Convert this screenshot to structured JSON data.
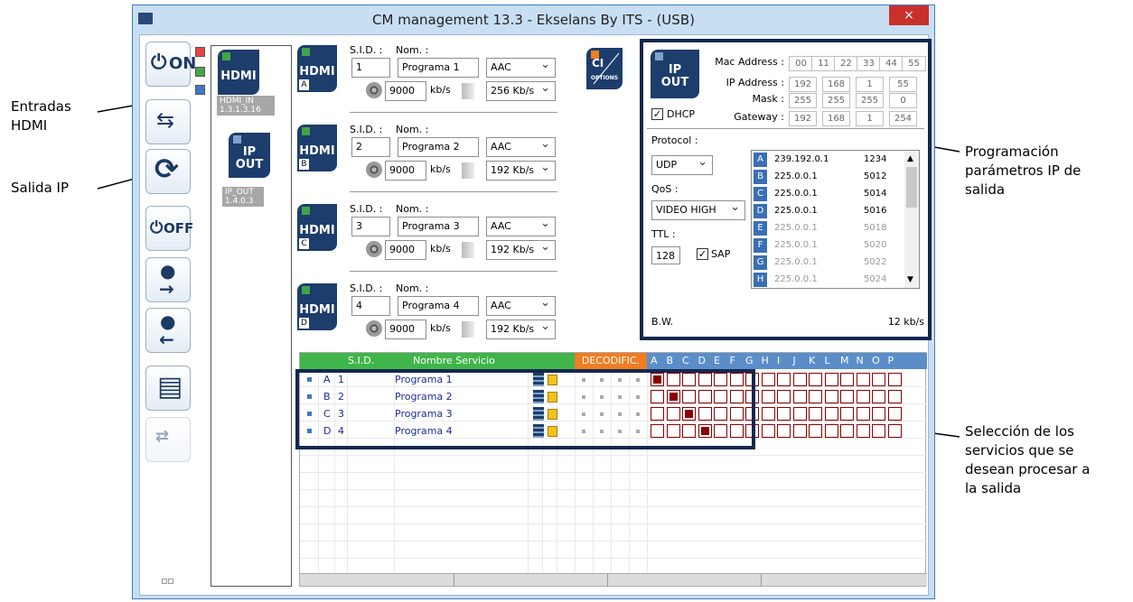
{
  "window": {
    "title": "CM management 13.3 - Ekselans By ITS - (USB)",
    "close_label": "×"
  },
  "callouts": {
    "hdmi_inputs": [
      "Entradas",
      "HDMI"
    ],
    "ip_output": "Salida IP",
    "ip_params": [
      "Programación",
      "parámetros IP de",
      "salida"
    ],
    "services": [
      "Selección de los",
      "servicios que se",
      "desean procesar a",
      "la salida"
    ]
  },
  "toolbar": {
    "on_label": "ON",
    "off_label": "OFF"
  },
  "sources": {
    "hdmi_tile": "HDMI",
    "hdmi_id": [
      "HDMI_IN",
      "1.3.1.3.16"
    ],
    "ipout_tile": [
      "IP",
      "OUT"
    ],
    "ipout_id": [
      "IP_OUT",
      "1.4.0.3"
    ]
  },
  "inputs_labels": {
    "sid": "S.I.D. :",
    "nom": "Nom. :",
    "kbs": "kb/s"
  },
  "inputs": [
    {
      "letter": "A",
      "tile": "HDMI",
      "sid": "1",
      "name": "Programa 1",
      "codec": "AAC",
      "rate": "9000",
      "audio_rate": "256 Kb/s"
    },
    {
      "letter": "B",
      "tile": "HDMI",
      "sid": "2",
      "name": "Programa 2",
      "codec": "AAC",
      "rate": "9000",
      "audio_rate": "192 Kb/s"
    },
    {
      "letter": "C",
      "tile": "HDMI",
      "sid": "3",
      "name": "Programa 3",
      "codec": "AAC",
      "rate": "9000",
      "audio_rate": "192 Kb/s"
    },
    {
      "letter": "D",
      "tile": "HDMI",
      "sid": "4",
      "name": "Programa 4",
      "codec": "AAC",
      "rate": "9000",
      "audio_rate": "192 Kb/s"
    }
  ],
  "ci": {
    "label": "CI",
    "sub": "OPTIONS"
  },
  "ipout": {
    "tile": [
      "IP",
      "OUT"
    ],
    "mac_label": "Mac Address :",
    "mac": [
      "00",
      "11",
      "22",
      "33",
      "44",
      "55"
    ],
    "ip_label": "IP Address :",
    "ip": [
      "192",
      "168",
      "1",
      "55"
    ],
    "mask_label": "Mask :",
    "mask": [
      "255",
      "255",
      "255",
      "0"
    ],
    "gw_label": "Gateway :",
    "gw": [
      "192",
      "168",
      "1",
      "254"
    ],
    "dhcp_label": "DHCP",
    "protocol_label": "Protocol :",
    "protocol": "UDP",
    "qos_label": "QoS :",
    "qos": "VIDEO HIGH",
    "ttl_label": "TTL :",
    "ttl": "128",
    "sap_label": "SAP",
    "bw_label": "B.W.",
    "bw_value": "12 kb/s",
    "streams": [
      {
        "letter": "A",
        "ip": "239.192.0.1",
        "port": "1234",
        "active": true
      },
      {
        "letter": "B",
        "ip": "225.0.0.1",
        "port": "5012",
        "active": true
      },
      {
        "letter": "C",
        "ip": "225.0.0.1",
        "port": "5014",
        "active": true
      },
      {
        "letter": "D",
        "ip": "225.0.0.1",
        "port": "5016",
        "active": true
      },
      {
        "letter": "E",
        "ip": "225.0.0.1",
        "port": "5018",
        "active": false
      },
      {
        "letter": "F",
        "ip": "225.0.0.1",
        "port": "5020",
        "active": false
      },
      {
        "letter": "G",
        "ip": "225.0.0.1",
        "port": "5022",
        "active": false
      },
      {
        "letter": "H",
        "ip": "225.0.0.1",
        "port": "5024",
        "active": false
      }
    ]
  },
  "services_table": {
    "col_sid": "S.I.D.",
    "col_name": "Nombre Servicio",
    "col_decod": "DECODIFIC.",
    "grid_letters": [
      "A",
      "B",
      "C",
      "D",
      "E",
      "F",
      "G",
      "H",
      "I",
      "J",
      "K",
      "L",
      "M",
      "N",
      "O",
      "P"
    ],
    "rows": [
      {
        "letter": "A",
        "sid": "1",
        "name": "Programa 1",
        "selected": 0
      },
      {
        "letter": "B",
        "sid": "2",
        "name": "Programa 2",
        "selected": 1
      },
      {
        "letter": "C",
        "sid": "3",
        "name": "Programa 3",
        "selected": 2
      },
      {
        "letter": "D",
        "sid": "4",
        "name": "Programa 4",
        "selected": 3
      }
    ]
  },
  "colors": {
    "navy": "#14274f",
    "tile": "#1d3d6c",
    "green_header": "#3fb54a",
    "orange_header": "#ef7d22",
    "blue_header": "#5b8ec9",
    "cell_red": "#8b0000"
  }
}
